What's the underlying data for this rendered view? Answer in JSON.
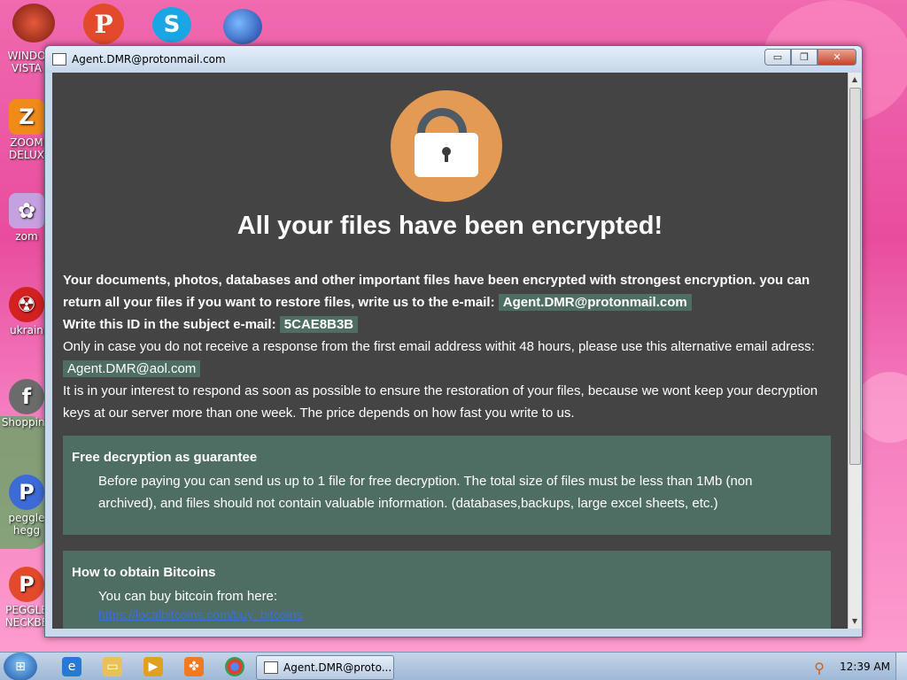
{
  "desktop": {
    "icons": [
      {
        "label": "WINDO VISTA",
        "icon": "vista-bowl-icon",
        "color": "#b33a2c"
      },
      {
        "label": "ZOOM DELUX",
        "icon": "zoom-icon",
        "color": "#f08a1a"
      },
      {
        "label": "zom",
        "icon": "flower-icon",
        "color": "#c7a0e0"
      },
      {
        "label": "ukrain",
        "icon": "radiation-icon",
        "color": "#d32020"
      },
      {
        "label": "Shopping",
        "icon": "flash-icon",
        "color": "#6b6b6b"
      },
      {
        "label": "peggle hegg",
        "icon": "peggle-icon",
        "color": "#3d6bd6"
      },
      {
        "label": "PEGGLE NECKBE",
        "icon": "peggle-icon",
        "color": "#e24a2b"
      }
    ],
    "top_icons": [
      {
        "icon": "bowl-icon",
        "color": "#b33a2c"
      },
      {
        "icon": "peggle-icon",
        "color": "#e24a2b"
      },
      {
        "icon": "skype-icon",
        "color": "#1aa6e4"
      },
      {
        "icon": "globe-icon",
        "color": "#2060c0"
      }
    ]
  },
  "window": {
    "title": "Agent.DMR@protonmail.com",
    "minimize": "▭",
    "maximize": "❐",
    "close": "✕"
  },
  "ransom": {
    "headline": "All your files have been encrypted!",
    "line1": "Your documents, photos, databases and other important files have been encrypted with strongest encryption. you can return all your files if you want to restore files, write us to the e-mail:",
    "email_primary": "Agent.DMR@protonmail.com",
    "id_label": "Write this ID in the subject e-mail:",
    "id_value": "5CAE8B3B",
    "line_alt": "Only in case you do not receive a response from the first email address withit 48 hours, please use this alternative email adress:",
    "email_alt": "Agent.DMR@aol.com",
    "line_interest": "It is in your interest to respond as soon as possible to ensure the restoration of your files, because we wont keep your decryption keys at our server more than one week. The price depends on how fast you write to us.",
    "panel1_title": "Free decryption as guarantee",
    "panel1_text": "Before paying you can send us up to 1 file for free decryption. The total size of files must be less than 1Mb (non archived), and files should not contain valuable information. (databases,backups, large excel sheets, etc.)",
    "panel2_title": "How to obtain Bitcoins",
    "panel2_text": "You can buy bitcoin from here:",
    "panel2_link": "https://localbitcoins.com/buy_bitcoins"
  },
  "taskbar": {
    "task_label": "Agent.DMR@proto...",
    "clock": "12:39 AM"
  },
  "colors": {
    "window_bg": "#444444",
    "accent_panel": "#4e6d63",
    "lock_orange": "#e39a55"
  }
}
